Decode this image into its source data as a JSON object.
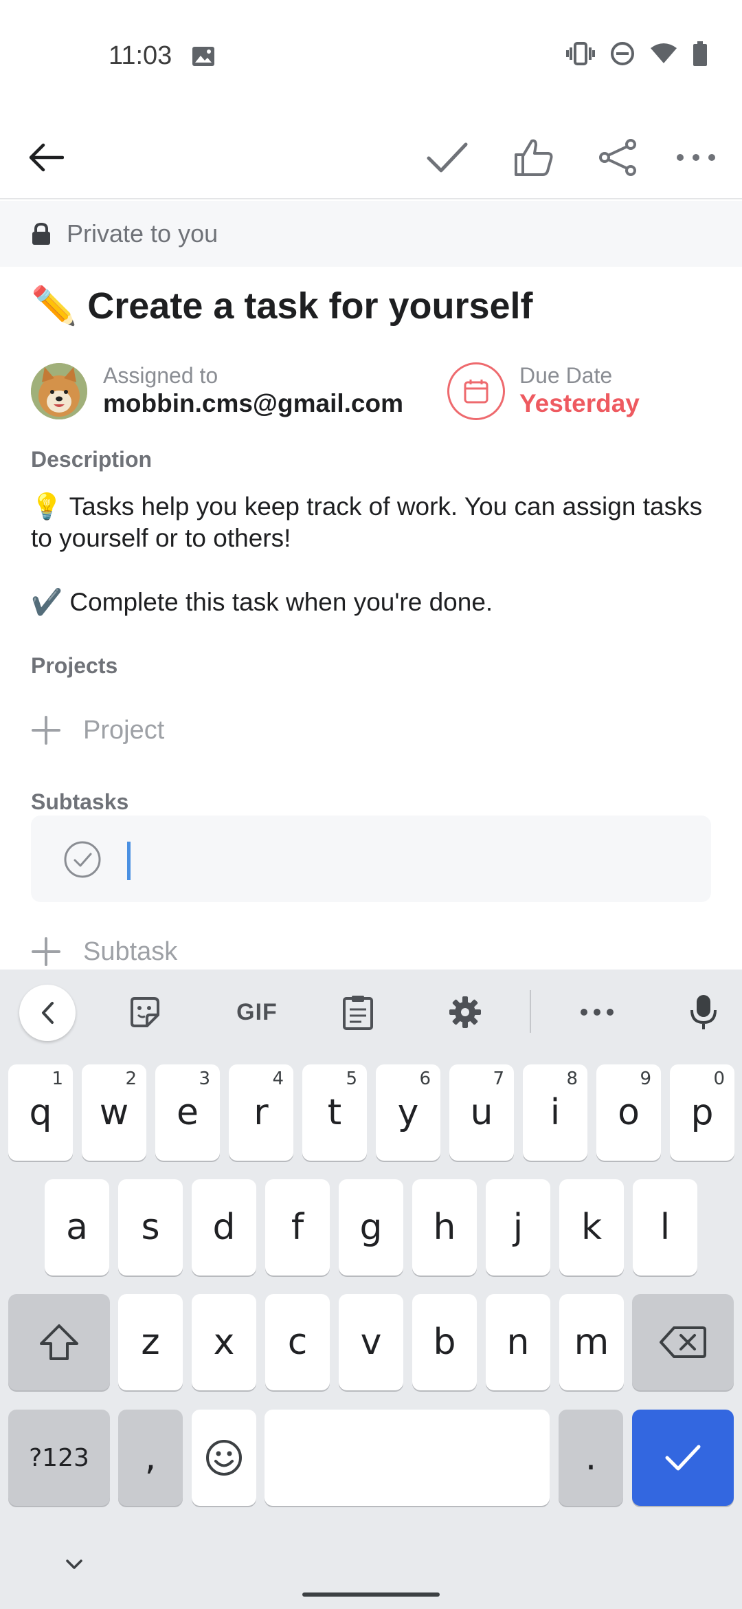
{
  "status_bar": {
    "time": "11:03"
  },
  "app_bar": {
    "icons": [
      "back-arrow-icon",
      "check-icon",
      "thumbs-up-icon",
      "share-icon",
      "more-icon"
    ]
  },
  "privacy": {
    "label": "Private to you"
  },
  "task": {
    "title_emoji": "✏️",
    "title": "Create a task for yourself",
    "assigned_label": "Assigned to",
    "assigned_value": "mobbin.cms@gmail.com",
    "due_label": "Due Date",
    "due_value": "Yesterday",
    "due_color": "#ee5a60"
  },
  "description": {
    "label": "Description",
    "line1": "💡 Tasks help you keep track of work. You can assign tasks to yourself or to others!",
    "line2": "✔️ Complete this task when you're done."
  },
  "projects": {
    "label": "Projects",
    "add_label": "Project"
  },
  "subtasks": {
    "label": "Subtasks",
    "input_value": "",
    "add_label": "Subtask"
  },
  "keyboard": {
    "toolbar": {
      "gif_label": "GIF"
    },
    "row1": [
      {
        "k": "q",
        "s": "1"
      },
      {
        "k": "w",
        "s": "2"
      },
      {
        "k": "e",
        "s": "3"
      },
      {
        "k": "r",
        "s": "4"
      },
      {
        "k": "t",
        "s": "5"
      },
      {
        "k": "y",
        "s": "6"
      },
      {
        "k": "u",
        "s": "7"
      },
      {
        "k": "i",
        "s": "8"
      },
      {
        "k": "o",
        "s": "9"
      },
      {
        "k": "p",
        "s": "0"
      }
    ],
    "row2": [
      "a",
      "s",
      "d",
      "f",
      "g",
      "h",
      "j",
      "k",
      "l"
    ],
    "row3": [
      "z",
      "x",
      "c",
      "v",
      "b",
      "n",
      "m"
    ],
    "symbols_label": "?123",
    "comma": ",",
    "period": ".",
    "accent_color": "#3367e0"
  }
}
